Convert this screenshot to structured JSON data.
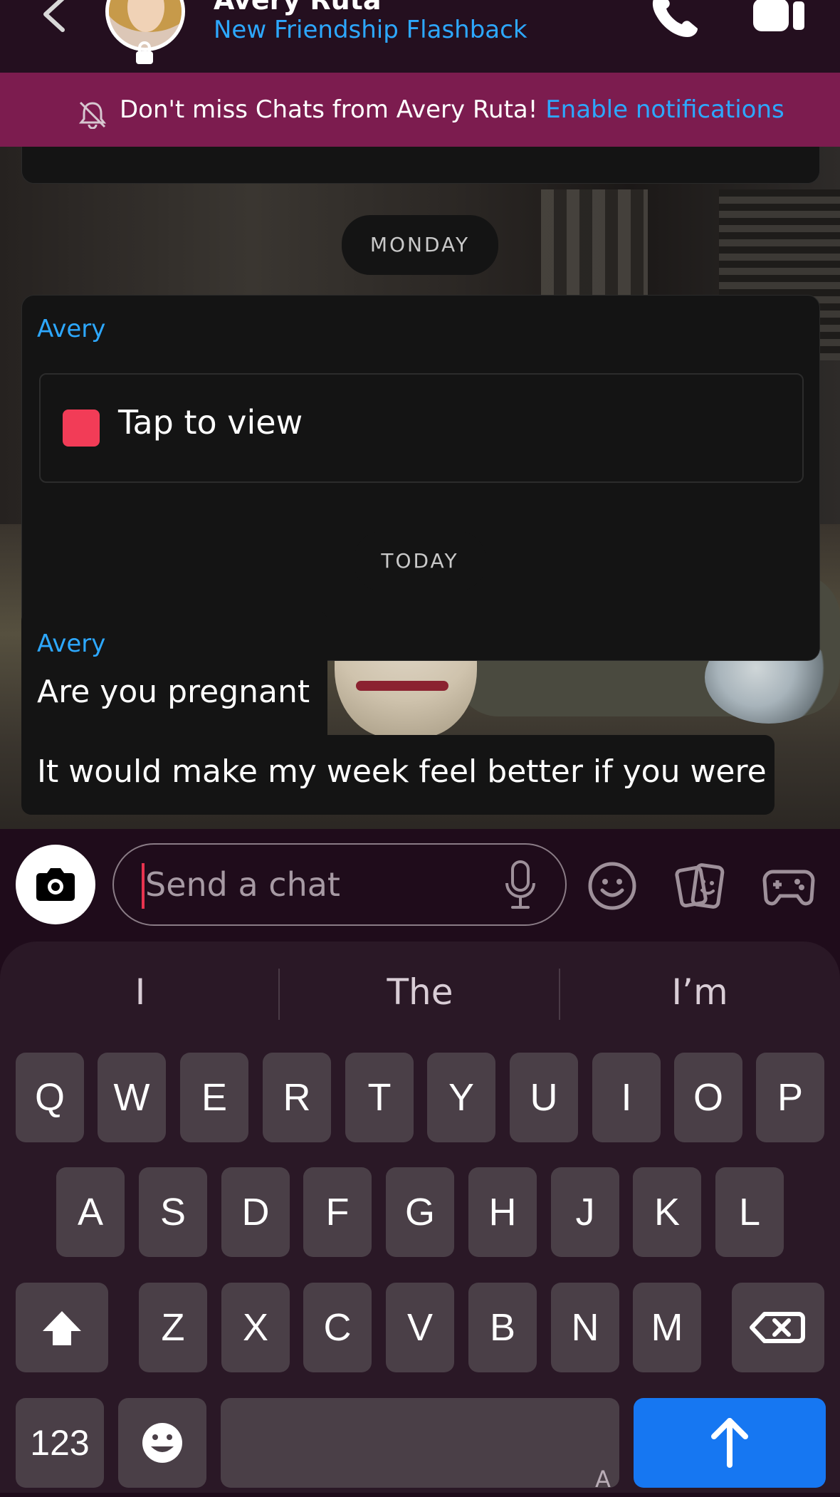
{
  "header": {
    "contact_name": "Avery Ruta",
    "subtitle": "New Friendship Flashback",
    "icons": [
      "back-chevron-icon",
      "avatar",
      "lock-icon",
      "phone-icon",
      "video-camera-icon"
    ]
  },
  "banner": {
    "message": "Don't miss Chats from Avery Ruta!",
    "link": "Enable notifications",
    "icon": "bell-off-icon"
  },
  "chat": {
    "day_separators": [
      "MONDAY",
      "TODAY"
    ],
    "snap_card": {
      "sender": "Avery",
      "label": "Tap to view",
      "color": "#f23c57"
    },
    "messages": [
      {
        "sender": "Avery",
        "text": "Are you pregnant"
      },
      {
        "text": "It would make my week feel better if you were"
      }
    ],
    "accent": "#2da8ff"
  },
  "input": {
    "placeholder": "Send a chat",
    "icons": [
      "camera-icon",
      "microphone-icon",
      "emoji-icon",
      "sticker-icon",
      "game-controller-icon"
    ]
  },
  "keyboard": {
    "suggestions": [
      "I",
      "The",
      "I’m"
    ],
    "row1": [
      "Q",
      "W",
      "E",
      "R",
      "T",
      "Y",
      "U",
      "I",
      "O",
      "P"
    ],
    "row2": [
      "A",
      "S",
      "D",
      "F",
      "G",
      "H",
      "J",
      "K",
      "L"
    ],
    "row3": [
      "Z",
      "X",
      "C",
      "V",
      "B",
      "N",
      "M"
    ],
    "numbers_key": "123",
    "space_hint": "A",
    "send_color": "#1677f2"
  }
}
